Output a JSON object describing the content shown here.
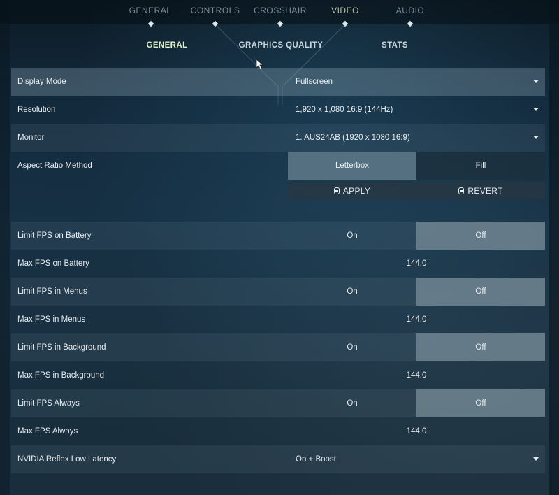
{
  "top_nav": {
    "tabs": [
      {
        "label": "GENERAL",
        "active": false
      },
      {
        "label": "CONTROLS",
        "active": false
      },
      {
        "label": "CROSSHAIR",
        "active": false
      },
      {
        "label": "VIDEO",
        "active": true
      },
      {
        "label": "AUDIO",
        "active": false
      }
    ]
  },
  "sub_nav": {
    "tabs": [
      {
        "label": "GENERAL",
        "active": true
      },
      {
        "label": "GRAPHICS QUALITY",
        "active": false
      },
      {
        "label": "STATS",
        "active": false
      }
    ]
  },
  "settings": {
    "display_mode": {
      "label": "Display Mode",
      "value": "Fullscreen"
    },
    "resolution": {
      "label": "Resolution",
      "value": "1,920 x 1,080 16:9 (144Hz)"
    },
    "monitor": {
      "label": "Monitor",
      "value": "1. AUS24AB (1920 x  1080 16:9)"
    },
    "aspect_ratio": {
      "label": "Aspect Ratio Method",
      "options": [
        "Letterbox",
        "Fill"
      ],
      "selected": "Letterbox"
    },
    "apply_label": "APPLY",
    "revert_label": "REVERT",
    "limit_fps_battery": {
      "label": "Limit FPS on Battery",
      "options": [
        "On",
        "Off"
      ],
      "selected": "Off"
    },
    "max_fps_battery": {
      "label": "Max FPS on Battery",
      "value": "144.0"
    },
    "limit_fps_menus": {
      "label": "Limit FPS in Menus",
      "options": [
        "On",
        "Off"
      ],
      "selected": "Off"
    },
    "max_fps_menus": {
      "label": "Max FPS in Menus",
      "value": "144.0"
    },
    "limit_fps_background": {
      "label": "Limit FPS in Background",
      "options": [
        "On",
        "Off"
      ],
      "selected": "Off"
    },
    "max_fps_background": {
      "label": "Max FPS in Background",
      "value": "144.0"
    },
    "limit_fps_always": {
      "label": "Limit FPS Always",
      "options": [
        "On",
        "Off"
      ],
      "selected": "Off"
    },
    "max_fps_always": {
      "label": "Max FPS Always",
      "value": "144.0"
    },
    "nvidia_reflex": {
      "label": "NVIDIA Reflex Low Latency",
      "value": "On + Boost"
    }
  },
  "icons": {
    "dropdown": "caret-down-icon",
    "apply": "lock-icon",
    "revert": "lock-icon",
    "cursor": "mouse-pointer-icon"
  }
}
